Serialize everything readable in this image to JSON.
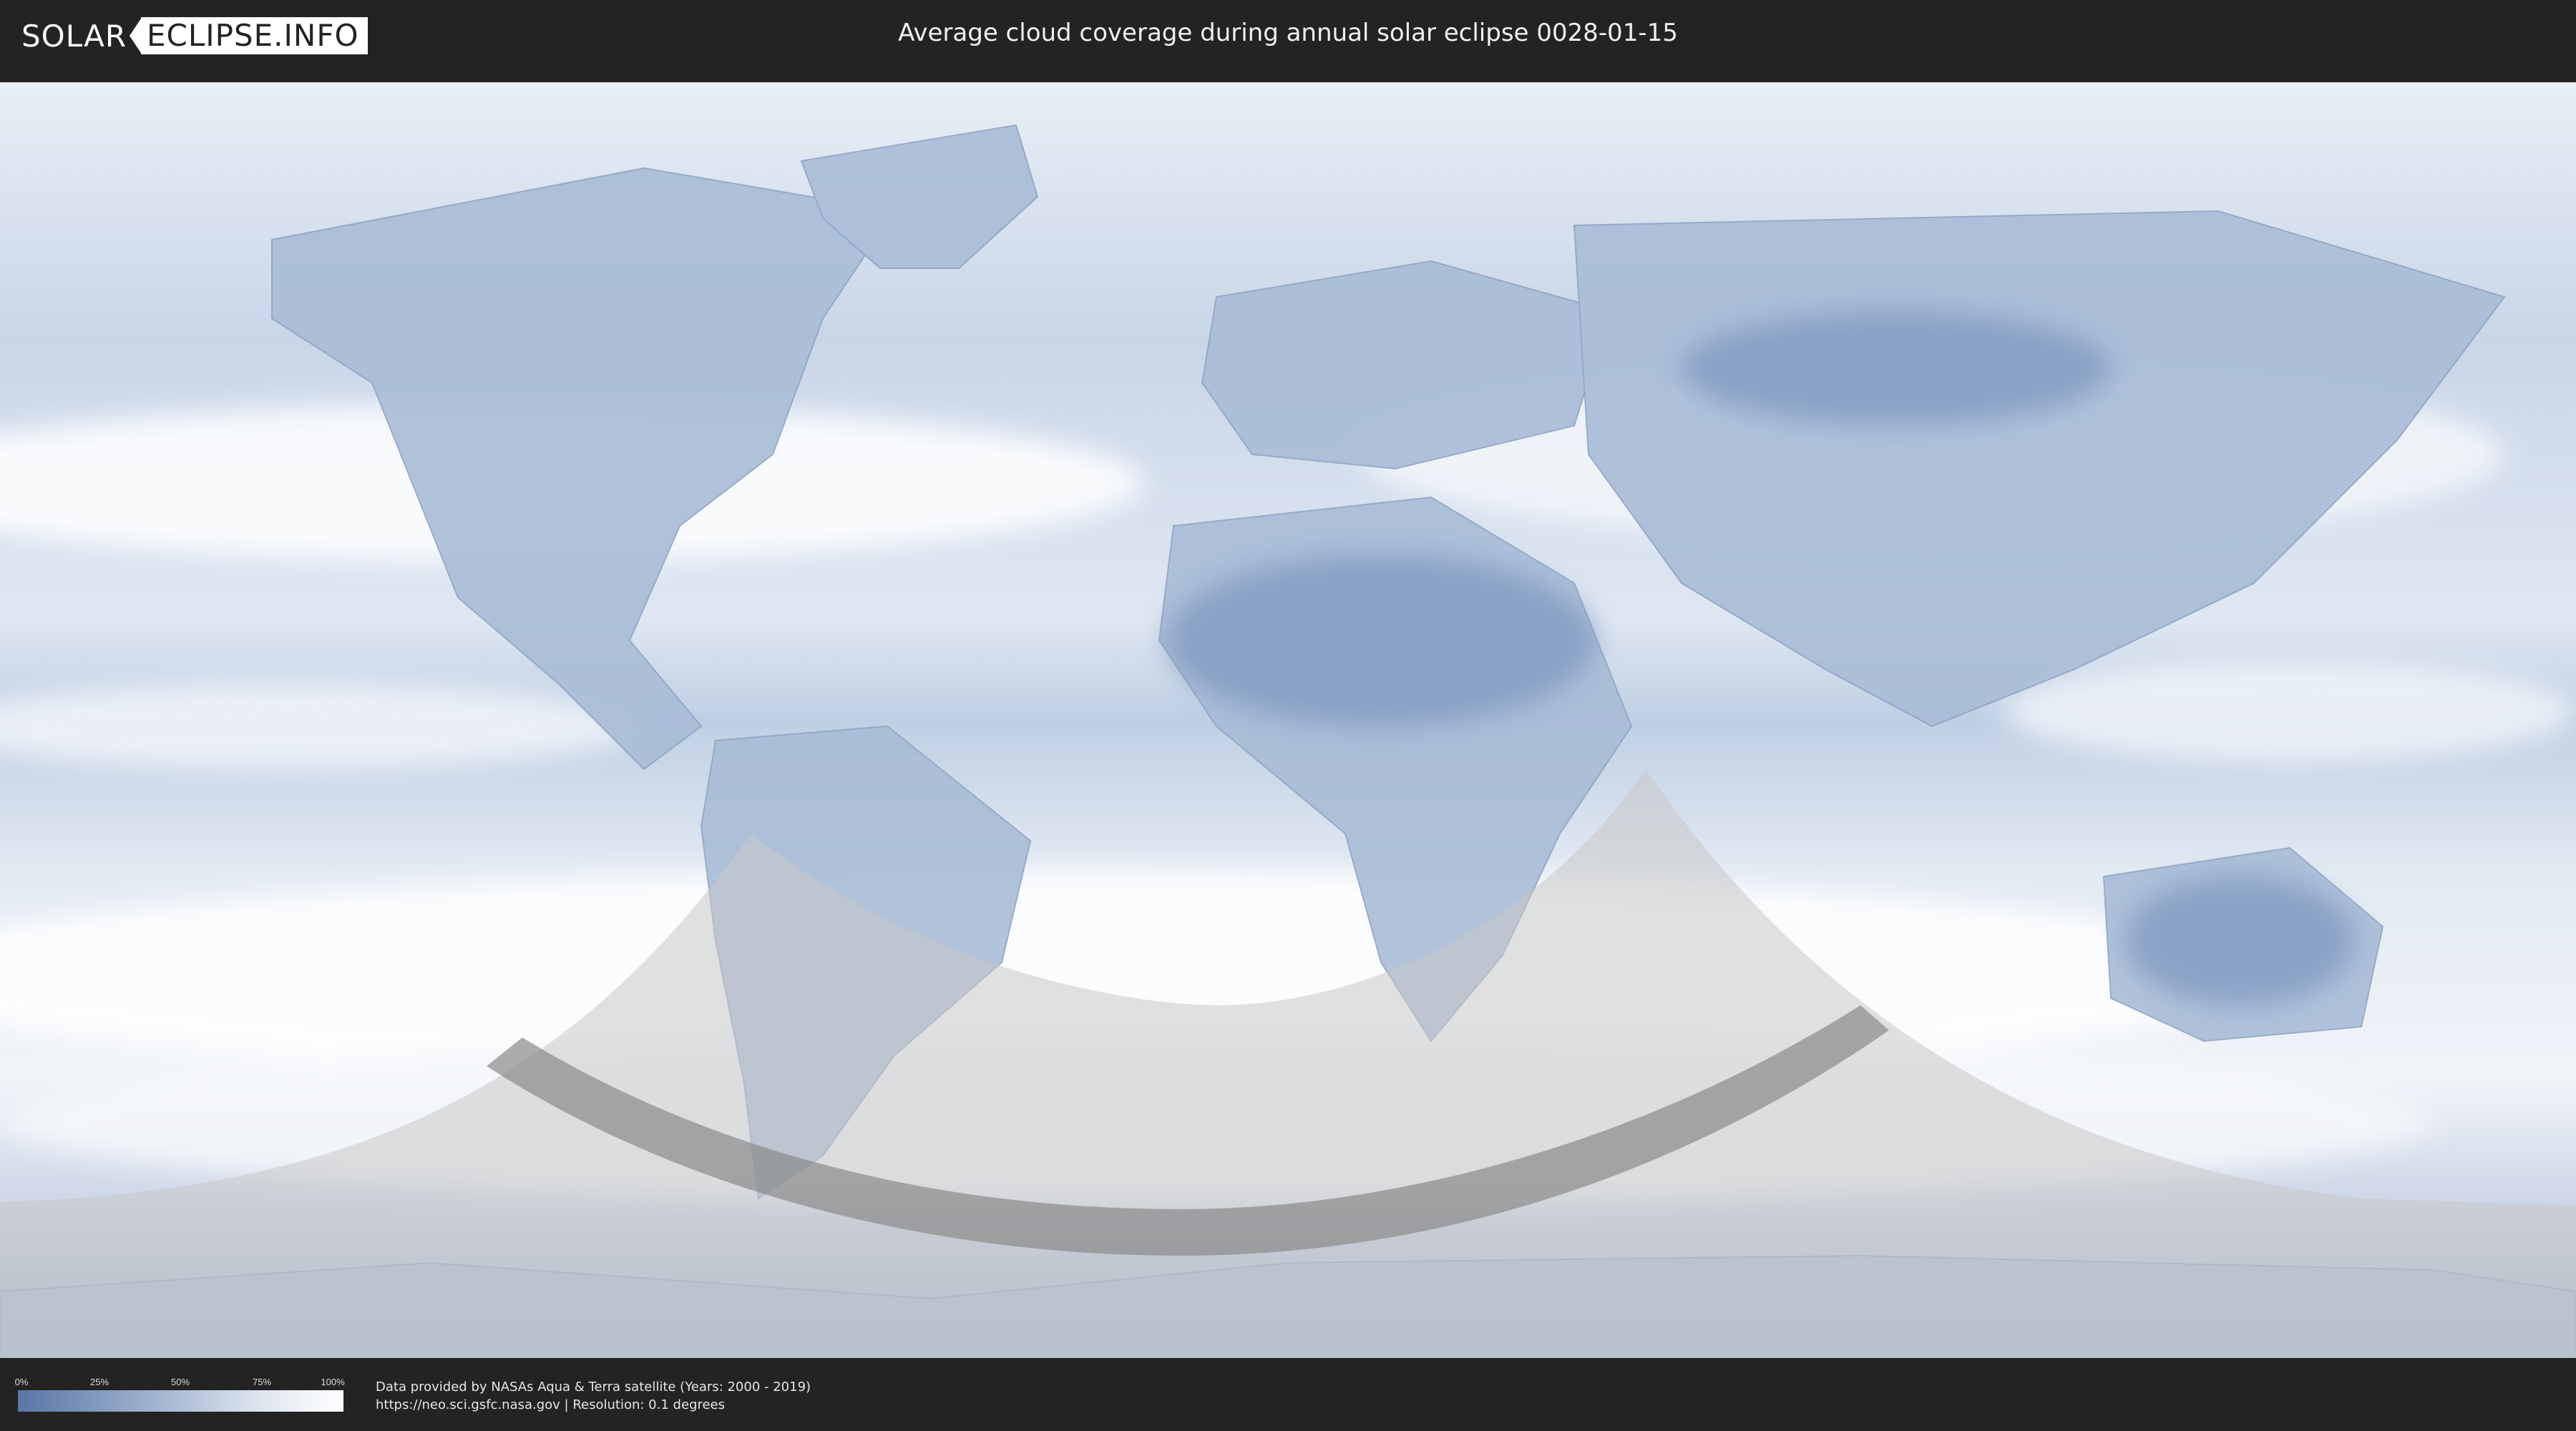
{
  "header": {
    "logo_left": "SOLAR",
    "logo_right": "ECLIPSE.INFO",
    "title": "Average cloud coverage during annual solar eclipse 0028-01-15"
  },
  "legend": {
    "ticks": [
      "0%",
      "25%",
      "50%",
      "75%",
      "100%"
    ],
    "colors": {
      "low": "#5a76a6",
      "high": "#ffffff"
    }
  },
  "footer": {
    "line1": "Data provided by NASAs Aqua & Terra satellite (Years: 2000 - 2019)",
    "line2": "https://neo.sci.gsfc.nasa.gov | Resolution: 0.1 degrees"
  },
  "map": {
    "ocean_color": "#d6e2ef",
    "cloud_color": "#ffffff",
    "land_color": "#7f98c0",
    "eclipse_zone_color": "#c8c8c8",
    "central_path_color": "#8a8a8a"
  }
}
